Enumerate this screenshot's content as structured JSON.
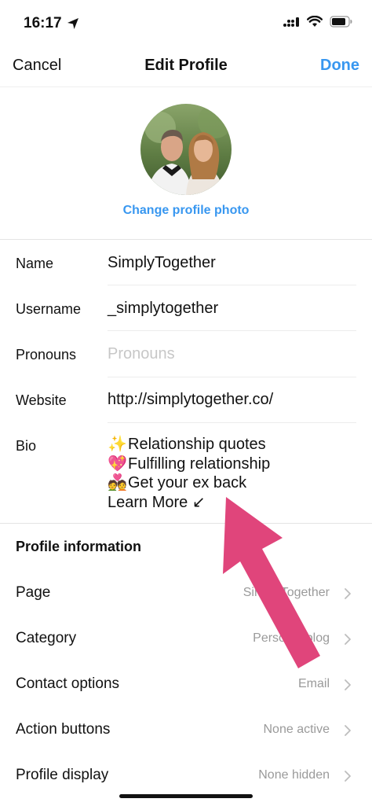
{
  "status_bar": {
    "time": "16:17",
    "icons": [
      "location-arrow-icon",
      "cellular-signal-icon",
      "wifi-icon",
      "battery-icon"
    ]
  },
  "nav": {
    "cancel_label": "Cancel",
    "title": "Edit Profile",
    "done_label": "Done"
  },
  "profile_photo": {
    "change_label": "Change profile photo"
  },
  "fields": {
    "name": {
      "label": "Name",
      "value": "SimplyTogether"
    },
    "username": {
      "label": "Username",
      "value": "_simplytogether"
    },
    "pronouns": {
      "label": "Pronouns",
      "placeholder": "Pronouns"
    },
    "website": {
      "label": "Website",
      "value": "http://simplytogether.co/"
    },
    "bio": {
      "label": "Bio",
      "lines": [
        {
          "emoji": "✨",
          "text": "Relationship quotes"
        },
        {
          "emoji": "💖",
          "text": "Fulfilling relationship"
        },
        {
          "emoji": "💑",
          "text": "Get your ex back"
        },
        {
          "emoji": "",
          "text": "Learn More ↙"
        }
      ]
    }
  },
  "profile_information": {
    "header": "Profile information",
    "rows": [
      {
        "label": "Page",
        "value": "SimplyTogether"
      },
      {
        "label": "Category",
        "value": "Personal blog"
      },
      {
        "label": "Contact options",
        "value": "Email"
      },
      {
        "label": "Action buttons",
        "value": "None active"
      },
      {
        "label": "Profile display",
        "value": "None hidden"
      }
    ]
  },
  "colors": {
    "accent": "#3897f0",
    "annotation_arrow": "#e0457b",
    "secondary_text": "#9a9a9a",
    "placeholder_text": "#c7c7c7"
  }
}
